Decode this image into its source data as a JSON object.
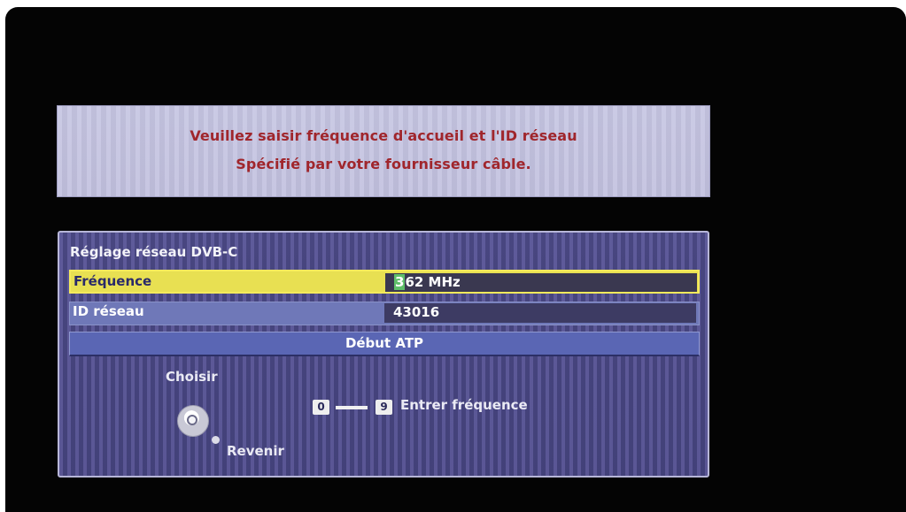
{
  "info": {
    "line1": "Veuillez saisir fréquence d'accueil et l'ID réseau",
    "line2": "Spécifié par votre fournisseur câble."
  },
  "panel": {
    "title": "Réglage réseau DVB-C",
    "frequency": {
      "label": "Fréquence",
      "value_cursor_char": "3",
      "value_rest": "62 MHz"
    },
    "network_id": {
      "label": "ID réseau",
      "value": "43016"
    },
    "start_button": "Début ATP",
    "hints": {
      "select": "Choisir",
      "back": "Revenir",
      "key_from": "0",
      "key_to": "9",
      "enter_frequency": "Entrer fréquence"
    }
  },
  "colors": {
    "highlight": "#e8e052",
    "panel_bg": "#4e4c8b",
    "info_text": "#a0262c",
    "cursor": "#5fbf6a"
  }
}
